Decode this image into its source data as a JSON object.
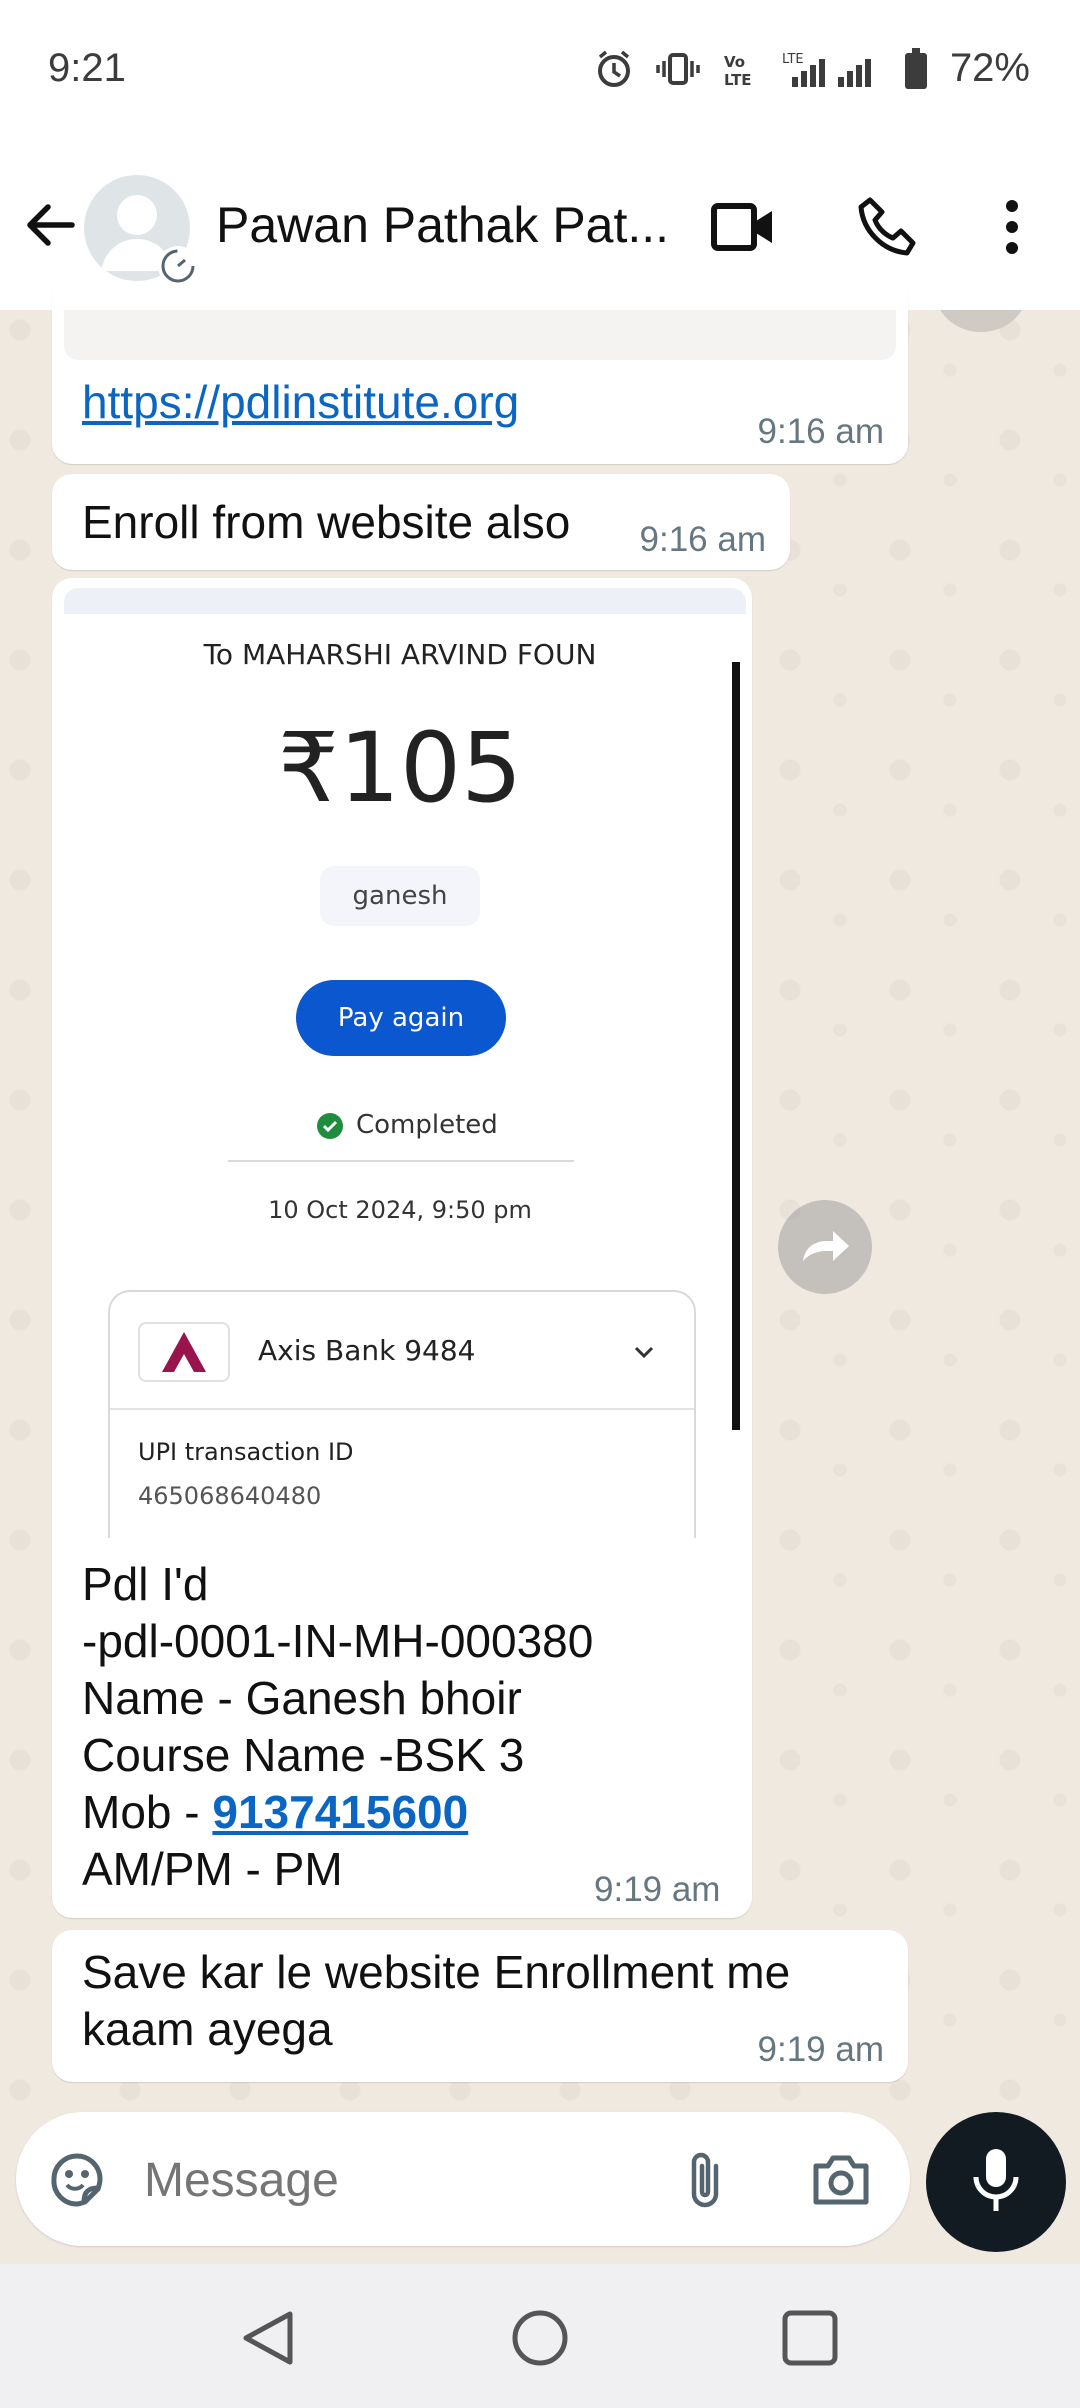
{
  "status_bar": {
    "time": "9:21",
    "battery": "72%"
  },
  "header": {
    "contact_name": "Pawan Pathak Pat..."
  },
  "messages": {
    "link": {
      "url": "https://pdlinstitute.org",
      "time": "9:16 am"
    },
    "enroll": {
      "text": "Enroll from website also",
      "time": "9:16 am"
    },
    "payment": {
      "recipient": "To MAHARSHI ARVIND FOUN",
      "amount": "₹105",
      "note": "ganesh",
      "pay_again": "Pay again",
      "status": "Completed",
      "datetime": "10 Oct 2024, 9:50 pm",
      "bank": "Axis Bank 9484",
      "upi_label": "UPI transaction ID",
      "upi_id": "465068640480"
    },
    "caption": {
      "line1": "Pdl I'd",
      "line2": "-pdl-0001-IN-MH-000380",
      "line3": "Name - Ganesh bhoir",
      "line4": "Course Name -BSK 3",
      "mob_label": "Mob - ",
      "mob_number": "9137415600",
      "line6": "AM/PM - PM",
      "time": "9:19 am"
    },
    "save": {
      "line1": "Save kar le website Enrollment me",
      "line2": "kaam ayega",
      "time": "9:19 am"
    }
  },
  "composer": {
    "placeholder": "Message"
  },
  "colors": {
    "accent_blue": "#0b57d0",
    "status_green": "#1e8e3e",
    "axis_red": "#97144d"
  }
}
